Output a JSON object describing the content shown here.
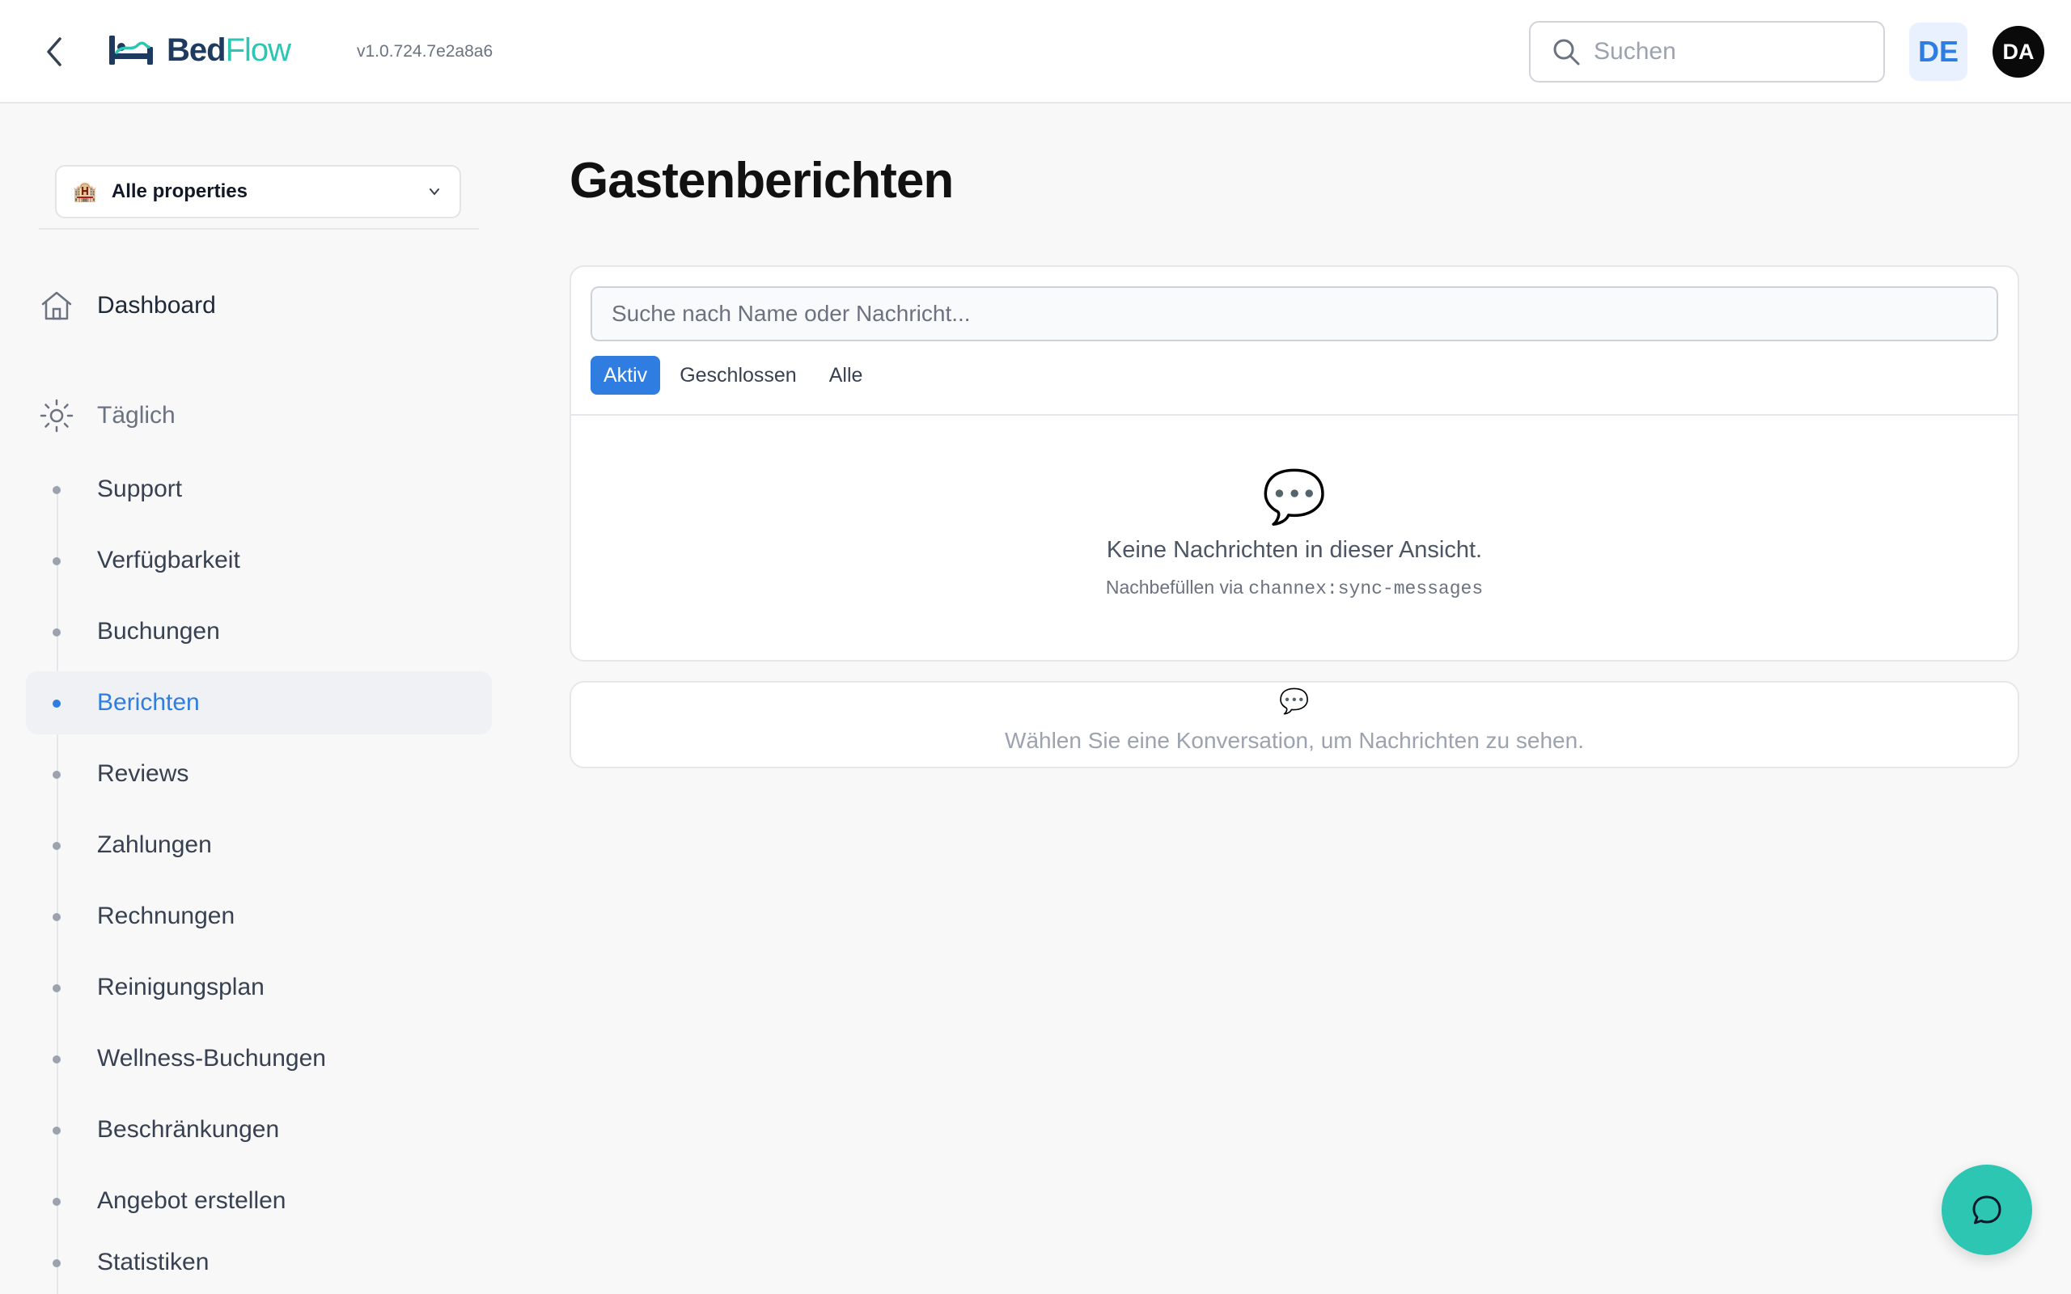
{
  "header": {
    "brand_part1": "Bed",
    "brand_part2": "Flow",
    "version": "v1.0.724.7e2a8a6",
    "search_placeholder": "Suchen",
    "language": "DE",
    "avatar_initials": "DA"
  },
  "sidebar": {
    "property_select": {
      "icon": "🏨",
      "label": "Alle properties"
    },
    "dashboard_label": "Dashboard",
    "section_label": "Täglich",
    "items": [
      {
        "label": "Support",
        "active": false
      },
      {
        "label": "Verfügbarkeit",
        "active": false
      },
      {
        "label": "Buchungen",
        "active": false
      },
      {
        "label": "Berichten",
        "active": true
      },
      {
        "label": "Reviews",
        "active": false
      },
      {
        "label": "Zahlungen",
        "active": false
      },
      {
        "label": "Rechnungen",
        "active": false
      },
      {
        "label": "Reinigungsplan",
        "active": false
      },
      {
        "label": "Wellness-Buchungen",
        "active": false
      },
      {
        "label": "Beschränkungen",
        "active": false
      },
      {
        "label": "Angebot erstellen",
        "active": false
      },
      {
        "label": "Statistiken",
        "active": false
      }
    ]
  },
  "main": {
    "title": "Gastenberichten",
    "search_placeholder": "Suche nach Name oder Nachricht...",
    "tabs": [
      {
        "label": "Aktiv",
        "active": true
      },
      {
        "label": "Geschlossen",
        "active": false
      },
      {
        "label": "Alle",
        "active": false
      }
    ],
    "empty_icon": "💬",
    "empty_title": "Keine Nachrichten in dieser Ansicht.",
    "empty_hint_prefix": "Nachbefüllen via ",
    "empty_hint_command": "channex:sync-messages",
    "detail_icon": "💬",
    "detail_placeholder": "Wählen Sie eine Konversation, um Nachrichten zu sehen."
  },
  "colors": {
    "accent_blue": "#2f7de1",
    "brand_teal": "#2cc6b3",
    "brand_navy": "#1e3a5f"
  },
  "icons": {
    "back": "chevron-left-icon",
    "search": "search-icon",
    "dashboard": "home-icon",
    "daily": "sun-icon",
    "select": "chevron-down-icon",
    "fab": "chat-bubble-icon"
  }
}
